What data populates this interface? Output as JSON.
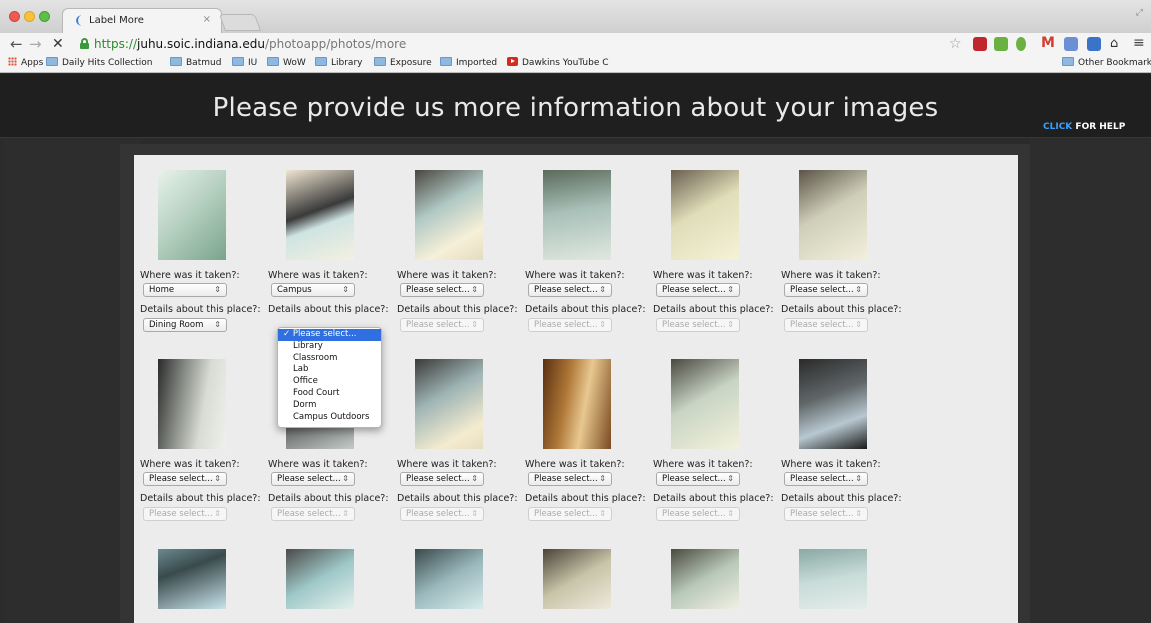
{
  "browser": {
    "tab_title": "Label More",
    "tab_close": "×",
    "url_scheme": "https://",
    "url_host": "juhu.soic.indiana.edu",
    "url_path": "/photoapp/photos/more",
    "bookmarks": [
      "Apps",
      "Daily Hits Collection",
      "Batmud",
      "IU",
      "WoW",
      "Library",
      "Exposure",
      "Imported",
      "Dawkins YouTube C"
    ],
    "other_bookmarks": "Other Bookmarks"
  },
  "page": {
    "title": "Please provide us more information about your images",
    "help_click": "CLICK",
    "help_rest": " FOR HELP"
  },
  "labels": {
    "where": "Where was it taken?:",
    "details": "Details about this place?:"
  },
  "rows": [
    {
      "where": [
        "Home",
        "Campus",
        "Please select...",
        "Please select...",
        "Please select...",
        "Please select..."
      ],
      "details": [
        "Dining Room",
        "",
        "Please select...",
        "Please select...",
        "Please select...",
        "Please select..."
      ]
    },
    {
      "where": [
        "Please select...",
        "Please select...",
        "Please select...",
        "Please select...",
        "Please select...",
        "Please select..."
      ],
      "details": [
        "Please select...",
        "Please select...",
        "Please select...",
        "Please select...",
        "Please select...",
        "Please select..."
      ]
    }
  ],
  "dropdown": {
    "selected": "✓ Please select...",
    "options": [
      "Library",
      "Classroom",
      "Lab",
      "Office",
      "Food Court",
      "Dorm",
      "Campus Outdoors"
    ]
  },
  "colors": {
    "accent": "#3aa0ff",
    "selection": "#2f6fe0"
  }
}
